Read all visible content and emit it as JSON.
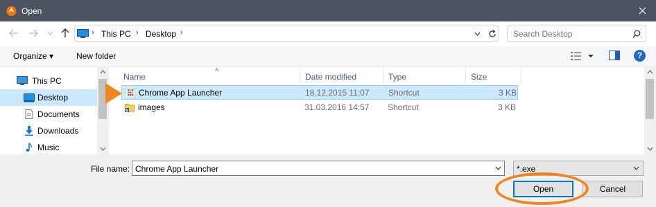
{
  "window": {
    "title": "Open",
    "app_icon": "avast-icon"
  },
  "address": {
    "crumbs": [
      "This PC",
      "Desktop"
    ],
    "search_placeholder": "Search Desktop"
  },
  "toolbar": {
    "organize_label": "Organize ▾",
    "new_folder_label": "New folder",
    "help_label": "?"
  },
  "nav": {
    "items": [
      {
        "label": "This PC",
        "icon": "computer-icon",
        "root": true,
        "selected": false
      },
      {
        "label": "Desktop",
        "icon": "desktop-icon",
        "root": false,
        "selected": true
      },
      {
        "label": "Documents",
        "icon": "documents-icon",
        "root": false,
        "selected": false
      },
      {
        "label": "Downloads",
        "icon": "downloads-icon",
        "root": false,
        "selected": false
      },
      {
        "label": "Music",
        "icon": "music-icon",
        "root": false,
        "selected": false
      }
    ]
  },
  "files": {
    "columns": [
      "Name",
      "Date modified",
      "Type",
      "Size"
    ],
    "rows": [
      {
        "name": "Chrome App Launcher",
        "date": "18.12.2015 11:07",
        "type": "Shortcut",
        "size": "3 KB",
        "icon": "chrome-app-launcher-shortcut-icon",
        "selected": true
      },
      {
        "name": "images",
        "date": "31.03.2016 14:57",
        "type": "Shortcut",
        "size": "3 KB",
        "icon": "folder-shortcut-icon",
        "selected": false
      }
    ]
  },
  "bottom": {
    "file_name_label": "File name:",
    "file_name_value": "Chrome App Launcher",
    "filter_value": "*.exe",
    "open_label": "Open",
    "cancel_label": "Cancel"
  },
  "colors": {
    "accent": "#0078d7",
    "highlight": "#f0841e",
    "selection": "#cce8ff",
    "titlebar": "#4b5460"
  }
}
